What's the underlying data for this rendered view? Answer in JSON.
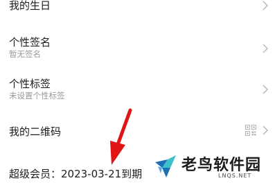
{
  "rows": [
    {
      "title": "我的生日"
    },
    {
      "title": "个性签名",
      "subtitle": "暂无签名"
    },
    {
      "title": "个性标签",
      "subtitle": "未设置个性标签"
    },
    {
      "title": "我的二维码",
      "icon": "qr-code-icon"
    }
  ],
  "member_status": "超级会员：2023-03-21到期",
  "watermark": {
    "name": "老鸟软件园",
    "url": "LNQS.NET"
  },
  "colors": {
    "arrow": "#e01515",
    "logo": "#1d6fb8",
    "logo_alt": "#3ec0c8"
  }
}
